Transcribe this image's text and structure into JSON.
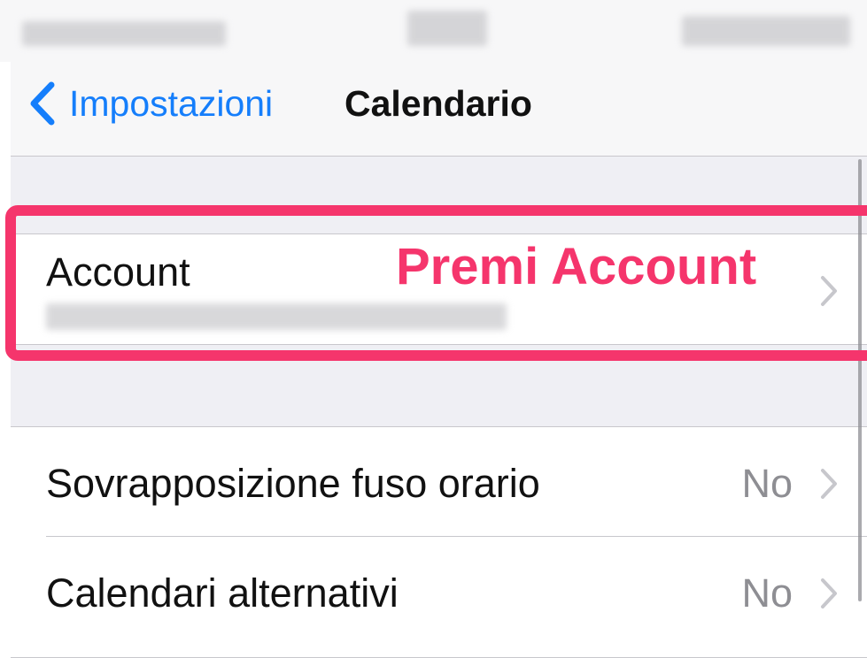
{
  "nav": {
    "back_label": "Impostazioni",
    "title": "Calendario"
  },
  "account_row": {
    "label": "Account"
  },
  "settings": [
    {
      "label": "Sovrapposizione fuso orario",
      "value": "No"
    },
    {
      "label": "Calendari alternativi",
      "value": "No"
    }
  ],
  "annotation": {
    "text": "Premi Account",
    "color": "#f5356c"
  },
  "colors": {
    "accent": "#157efb",
    "secondary_text": "#8e8e93",
    "grouped_background": "#efeff4"
  },
  "icons": [
    "chevron-left-icon",
    "chevron-right-icon"
  ]
}
